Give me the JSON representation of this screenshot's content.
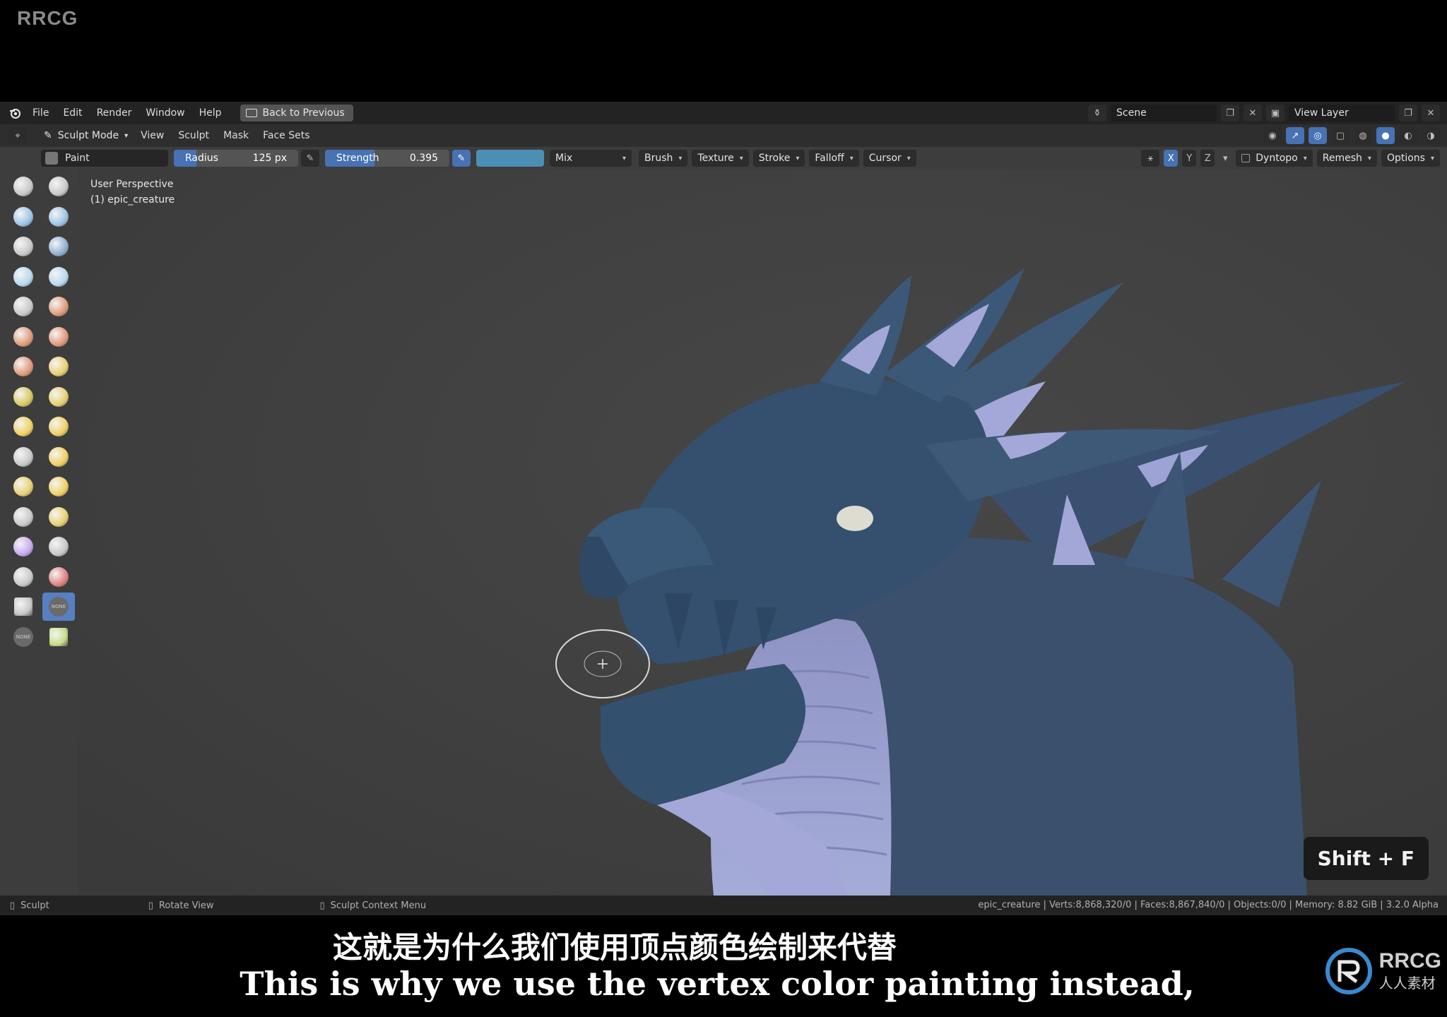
{
  "watermark": {
    "corner": "RRCG"
  },
  "topbar": {
    "menu": [
      "File",
      "Edit",
      "Render",
      "Window",
      "Help"
    ],
    "back_button": "Back to Previous",
    "scene": "Scene",
    "view_layer": "View Layer"
  },
  "header": {
    "mode": "Sculpt Mode",
    "menu": [
      "View",
      "Sculpt",
      "Mask",
      "Face Sets"
    ]
  },
  "tool_header": {
    "brush_name": "Paint",
    "radius_label": "Radius",
    "radius_value": "125 px",
    "strength_label": "Strength",
    "strength_value": "0.395",
    "strength_fraction": 0.395,
    "color": "#4b8fb5",
    "blend": "Mix",
    "menus": [
      "Brush",
      "Texture",
      "Stroke",
      "Falloff",
      "Cursor"
    ],
    "axes": [
      "X",
      "Y",
      "Z"
    ],
    "dyntopo": "Dyntopo",
    "remesh": "Remesh",
    "options": "Options"
  },
  "toolbar": {
    "none_label": "NONE",
    "tools": [
      {
        "name": "draw",
        "color": "#c8c8c8"
      },
      {
        "name": "draw-sharp",
        "color": "#c8c8c8"
      },
      {
        "name": "clay",
        "color": "#9cc4e4"
      },
      {
        "name": "clay-strips",
        "color": "#9cc4e4"
      },
      {
        "name": "clay-thumb",
        "color": "#c8c8c8"
      },
      {
        "name": "layer",
        "color": "#8fb0d0"
      },
      {
        "name": "inflate",
        "color": "#b8d8f0"
      },
      {
        "name": "blob",
        "color": "#b8d8f0"
      },
      {
        "name": "crease",
        "color": "#c8c8c8"
      },
      {
        "name": "smooth",
        "color": "#e09a7a"
      },
      {
        "name": "flatten",
        "color": "#e09a7a"
      },
      {
        "name": "fill",
        "color": "#e09a7a"
      },
      {
        "name": "scrape",
        "color": "#e09a7a"
      },
      {
        "name": "multiplane-scrape",
        "color": "#e8d070"
      },
      {
        "name": "pinch",
        "color": "#d8c860"
      },
      {
        "name": "grab",
        "color": "#e8d070"
      },
      {
        "name": "elastic-deform",
        "color": "#f0d060"
      },
      {
        "name": "snake-hook",
        "color": "#f0d060"
      },
      {
        "name": "thumb",
        "color": "#c8c8c8"
      },
      {
        "name": "pose",
        "color": "#f0d060"
      },
      {
        "name": "nudge",
        "color": "#e8d070"
      },
      {
        "name": "rotate",
        "color": "#f0d060"
      },
      {
        "name": "slide-relax",
        "color": "#c8c8c8"
      },
      {
        "name": "boundary",
        "color": "#e8d070"
      },
      {
        "name": "cloth",
        "color": "#c8a8f0"
      },
      {
        "name": "simplify",
        "color": "#c8c8c8"
      },
      {
        "name": "mask",
        "color": "#c8c8c8"
      },
      {
        "name": "draw-face-sets",
        "color": "#e08080"
      },
      {
        "name": "multires-displacement-eraser",
        "color": "#c8c8c8"
      },
      {
        "name": "paint",
        "color": "#6a6a6a",
        "active": true,
        "none": true
      },
      {
        "name": "smear",
        "color": "#6a6a6a",
        "none": true
      },
      {
        "name": "extra",
        "color": "#c8e088"
      }
    ]
  },
  "viewport": {
    "perspective": "User Perspective",
    "object": "(1) epic_creature",
    "shortcut": "Shift + F"
  },
  "statusbar": {
    "left": "Sculpt",
    "middle": "Rotate View",
    "context": "Sculpt Context Menu",
    "stats": "epic_creature | Verts:8,868,320/0 | Faces:8,867,840/0 | Objects:0/0 | Memory: 8.82 GiB | 3.2.0 Alpha"
  },
  "subtitles": {
    "chinese": "这就是为什么我们使用顶点颜色绘制来代替",
    "english": "This is why we use the vertex color painting instead,"
  },
  "brand": {
    "name": "RRCG",
    "sub": "人人素材"
  }
}
